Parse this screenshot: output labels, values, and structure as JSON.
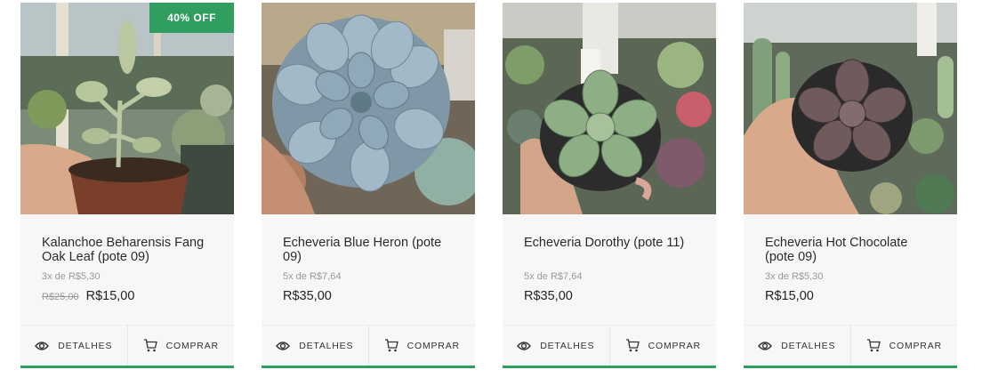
{
  "products": [
    {
      "name": "Kalanchoe Beharensis Fang Oak Leaf (pote 09)",
      "badge": "40% OFF",
      "installments": "3x de R$5,30",
      "old_price": "R$25,00",
      "price": "R$15,00",
      "details_label": "DETALHES",
      "buy_label": "COMPRAR"
    },
    {
      "name": "Echeveria Blue Heron (pote 09)",
      "installments": "5x de R$7,64",
      "price": "R$35,00",
      "details_label": "DETALHES",
      "buy_label": "COMPRAR"
    },
    {
      "name": "Echeveria Dorothy (pote 11)",
      "installments": "5x de R$7,64",
      "price": "R$35,00",
      "details_label": "DETALHES",
      "buy_label": "COMPRAR"
    },
    {
      "name": "Echeveria Hot Chocolate (pote 09)",
      "installments": "3x de R$5,30",
      "price": "R$15,00",
      "details_label": "DETALHES",
      "buy_label": "COMPRAR"
    }
  ],
  "icons": {
    "details": "eye-icon",
    "buy": "cart-icon"
  },
  "colors": {
    "accent": "#2f9e5f"
  }
}
